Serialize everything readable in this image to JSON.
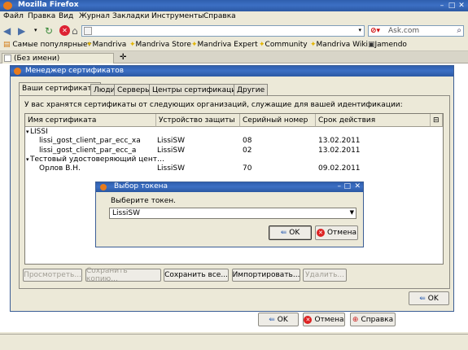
{
  "window": {
    "title": "Mozilla Firefox"
  },
  "menubar": [
    "Файл",
    "Правка",
    "Вид",
    "Журнал",
    "Закладки",
    "Инструменты",
    "Справка"
  ],
  "navbar": {
    "search_placeholder": "Ask.com"
  },
  "bookmarks": [
    "Самые популярные▾",
    "Mandriva",
    "Mandriva Store",
    "Mandriva Expert",
    "Community",
    "Mandriva Wiki",
    "Jamendo"
  ],
  "tabs": {
    "current_tab": "(Без имени)"
  },
  "cert_manager": {
    "title": "Менеджер сертификатов",
    "tabs": [
      "Ваши сертификаты",
      "Люди",
      "Серверы",
      "Центры сертификации",
      "Другие"
    ],
    "description": "У вас хранятся сертификаты от следующих организаций, служащие для вашей идентификации:",
    "columns": [
      "Имя сертификата",
      "Устройство защиты",
      "Серийный номер",
      "Срок действия"
    ],
    "rows": [
      {
        "name": "LISSI",
        "device": "",
        "serial": "",
        "expires": "",
        "group": true
      },
      {
        "name": "lissi_gost_client_par_ecc_xa",
        "device": "LissiSW",
        "serial": "08",
        "expires": "13.02.2011",
        "group": false
      },
      {
        "name": "lissi_gost_client_par_ecc_a",
        "device": "LissiSW",
        "serial": "02",
        "expires": "13.02.2011",
        "group": false
      },
      {
        "name": "Тестовый удостоверяющий цент…",
        "device": "",
        "serial": "",
        "expires": "",
        "group": true
      },
      {
        "name": "Орлов В.Н.",
        "device": "LissiSW",
        "serial": "70",
        "expires": "09.02.2011",
        "group": false
      }
    ],
    "buttons": {
      "view": "Просмотреть...",
      "backup": "Сохранить копию...",
      "backup_all": "Сохранить все...",
      "import": "Импортировать...",
      "delete": "Удалить...",
      "ok": "OK"
    }
  },
  "token_dialog": {
    "title": "Выбор токена",
    "prompt": "Выберите токен.",
    "selected": "LissiSW",
    "ok": "OK",
    "cancel": "Отмена"
  },
  "bottom_buttons": {
    "ok": "OK",
    "cancel": "Отмена",
    "help": "Справка"
  }
}
